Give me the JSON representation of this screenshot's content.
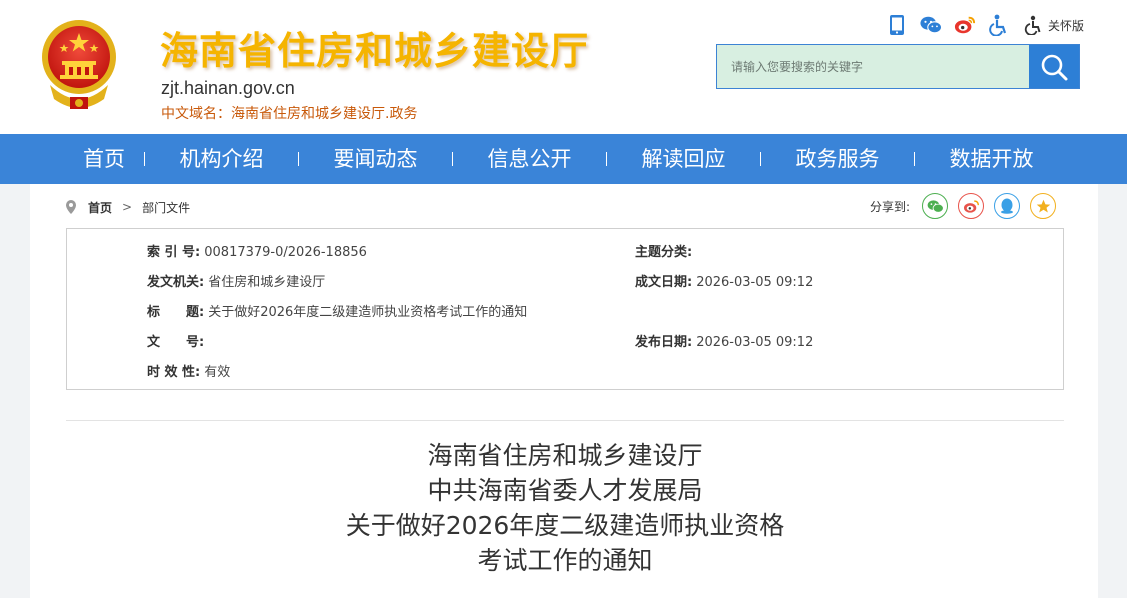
{
  "header": {
    "site_title": "海南省住房和城乡建设厅",
    "domain": "zjt.hainan.gov.cn",
    "cn_domain_label": "中文域名：",
    "cn_domain_value": "海南省住房和城乡建设厅.政务",
    "tools": [
      {
        "icon": "mobile-icon"
      },
      {
        "icon": "wechat-icon"
      },
      {
        "icon": "weibo-icon"
      },
      {
        "icon": "accessibility-icon"
      }
    ],
    "care_mode_label": "关怀版",
    "search_placeholder": "请输入您要搜索的关键字"
  },
  "nav": {
    "items": [
      {
        "label": "首页"
      },
      {
        "label": "机构介绍"
      },
      {
        "label": "要闻动态"
      },
      {
        "label": "信息公开"
      },
      {
        "label": "解读回应"
      },
      {
        "label": "政务服务"
      },
      {
        "label": "数据开放"
      }
    ]
  },
  "breadcrumb": {
    "home": "首页",
    "separator": ">",
    "current": "部门文件"
  },
  "share": {
    "label": "分享到:",
    "buttons": [
      {
        "icon": "wechat-icon",
        "color": "#4caf50"
      },
      {
        "icon": "weibo-icon",
        "color": "#e8534a"
      },
      {
        "icon": "qq-icon",
        "color": "#3aa0e6"
      },
      {
        "icon": "qzone-icon",
        "color": "#f2b01e"
      }
    ]
  },
  "meta": {
    "index_label": "索 引 号:",
    "index_value": "00817379-0/2026-18856",
    "topic_label": "主题分类:",
    "topic_value": "",
    "issuer_label": "发文机关:",
    "issuer_value": "省住房和城乡建设厅",
    "created_label": "成文日期:",
    "created_value": "2026-03-05 09:12",
    "title_label": "标　　题:",
    "title_value": "关于做好2026年度二级建造师执业资格考试工作的通知",
    "doc_no_label": "文　　号:",
    "doc_no_value": "",
    "published_label": "发布日期:",
    "published_value": "2026-03-05 09:12",
    "validity_label": "时 效 性:",
    "validity_value": "有效"
  },
  "document": {
    "title_lines": [
      "海南省住房和城乡建设厅",
      "中共海南省委人才发展局",
      "关于做好2026年度二级建造师执业资格",
      "考试工作的通知"
    ]
  },
  "colors": {
    "nav_bg": "#3a84d8",
    "title_gold": "#f5b400",
    "search_bg": "#d8efe1",
    "search_btn": "#2d7fd6"
  }
}
